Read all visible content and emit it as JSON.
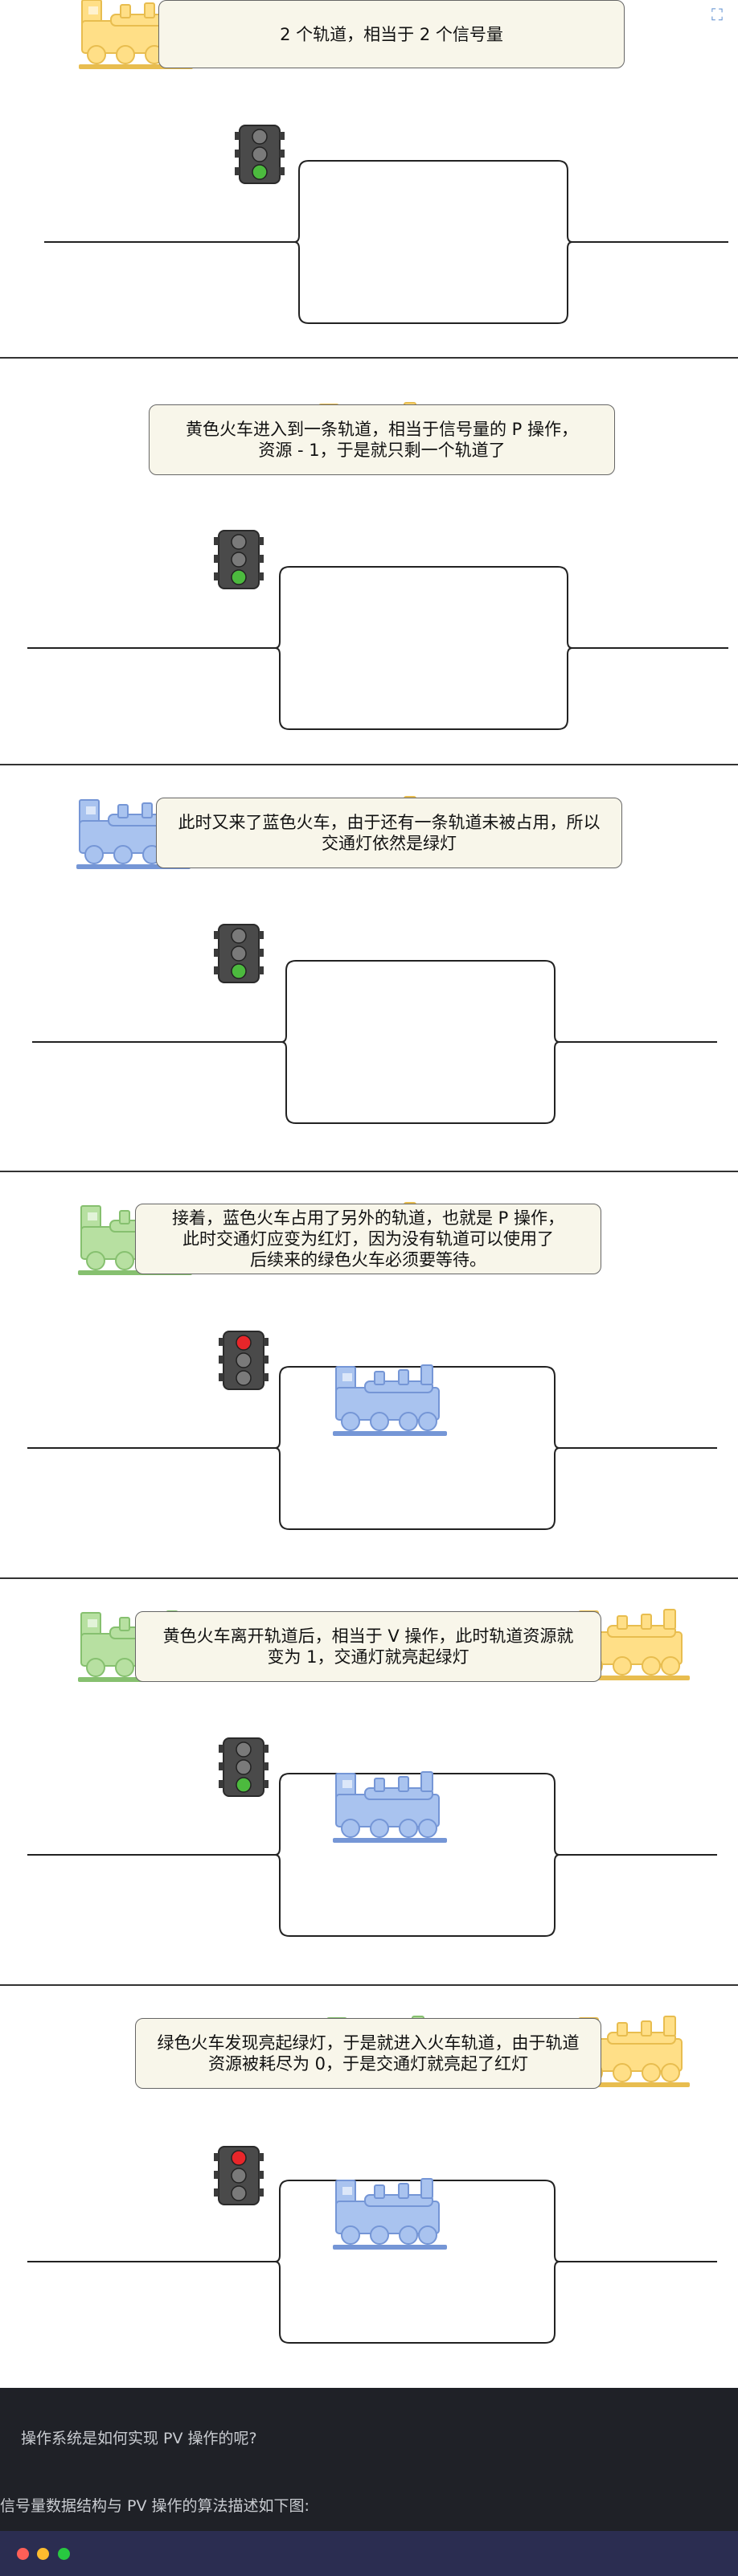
{
  "panels": [
    {
      "caption": "2 个轨道，相当于 2 个信号量",
      "light": "green",
      "trains": [
        {
          "color": "yellow",
          "spot": "waiting"
        }
      ]
    },
    {
      "caption": "黄色火车进入到一条轨道，相当于信号量的 P 操作，\n资源 - 1，于是就只剩一个轨道了",
      "light": "green",
      "trains": [
        {
          "color": "yellow",
          "spot": "upper"
        }
      ]
    },
    {
      "caption": "此时又来了蓝色火车，由于还有一条轨道未被占用，所以\n交通灯依然是绿灯",
      "light": "green",
      "trains": [
        {
          "color": "yellow",
          "spot": "upper"
        },
        {
          "color": "blue",
          "spot": "waiting"
        }
      ]
    },
    {
      "caption": "接着，蓝色火车占用了另外的轨道，也就是 P 操作，\n此时交通灯应变为红灯，因为没有轨道可以使用了\n后续来的绿色火车必须要等待。",
      "light": "red",
      "trains": [
        {
          "color": "yellow",
          "spot": "upper"
        },
        {
          "color": "blue",
          "spot": "lower"
        },
        {
          "color": "green",
          "spot": "waiting"
        }
      ]
    },
    {
      "caption": "黄色火车离开轨道后，相当于 V 操作，此时轨道资源就\n变为 1，交通灯就亮起绿灯",
      "light": "green",
      "trains": [
        {
          "color": "green",
          "spot": "waiting"
        },
        {
          "color": "blue",
          "spot": "lower"
        },
        {
          "color": "yellow",
          "spot": "exit"
        }
      ]
    },
    {
      "caption": "绿色火车发现亮起绿灯，于是就进入火车轨道，由于轨道\n资源被耗尽为 0，于是交通灯就亮起了红灯",
      "light": "red",
      "trains": [
        {
          "color": "green",
          "spot": "upper"
        },
        {
          "color": "blue",
          "spot": "lower"
        },
        {
          "color": "yellow",
          "spot": "exit"
        }
      ]
    }
  ],
  "colors": {
    "yellow": {
      "fill": "#ffdf87",
      "stroke": "#e8bd4f"
    },
    "blue": {
      "fill": "#a9c3ef",
      "stroke": "#7596d6"
    },
    "green": {
      "fill": "#b7e0a1",
      "stroke": "#86c06f"
    },
    "light_on_green": "#4cba3e",
    "light_on_red": "#e8262a"
  },
  "bottom": {
    "question": "操作系统是如何实现 PV 操作的呢?",
    "description": "信号量数据结构与 PV 操作的算法描述如下图:"
  },
  "icons": {
    "expand": "expand-icon"
  }
}
